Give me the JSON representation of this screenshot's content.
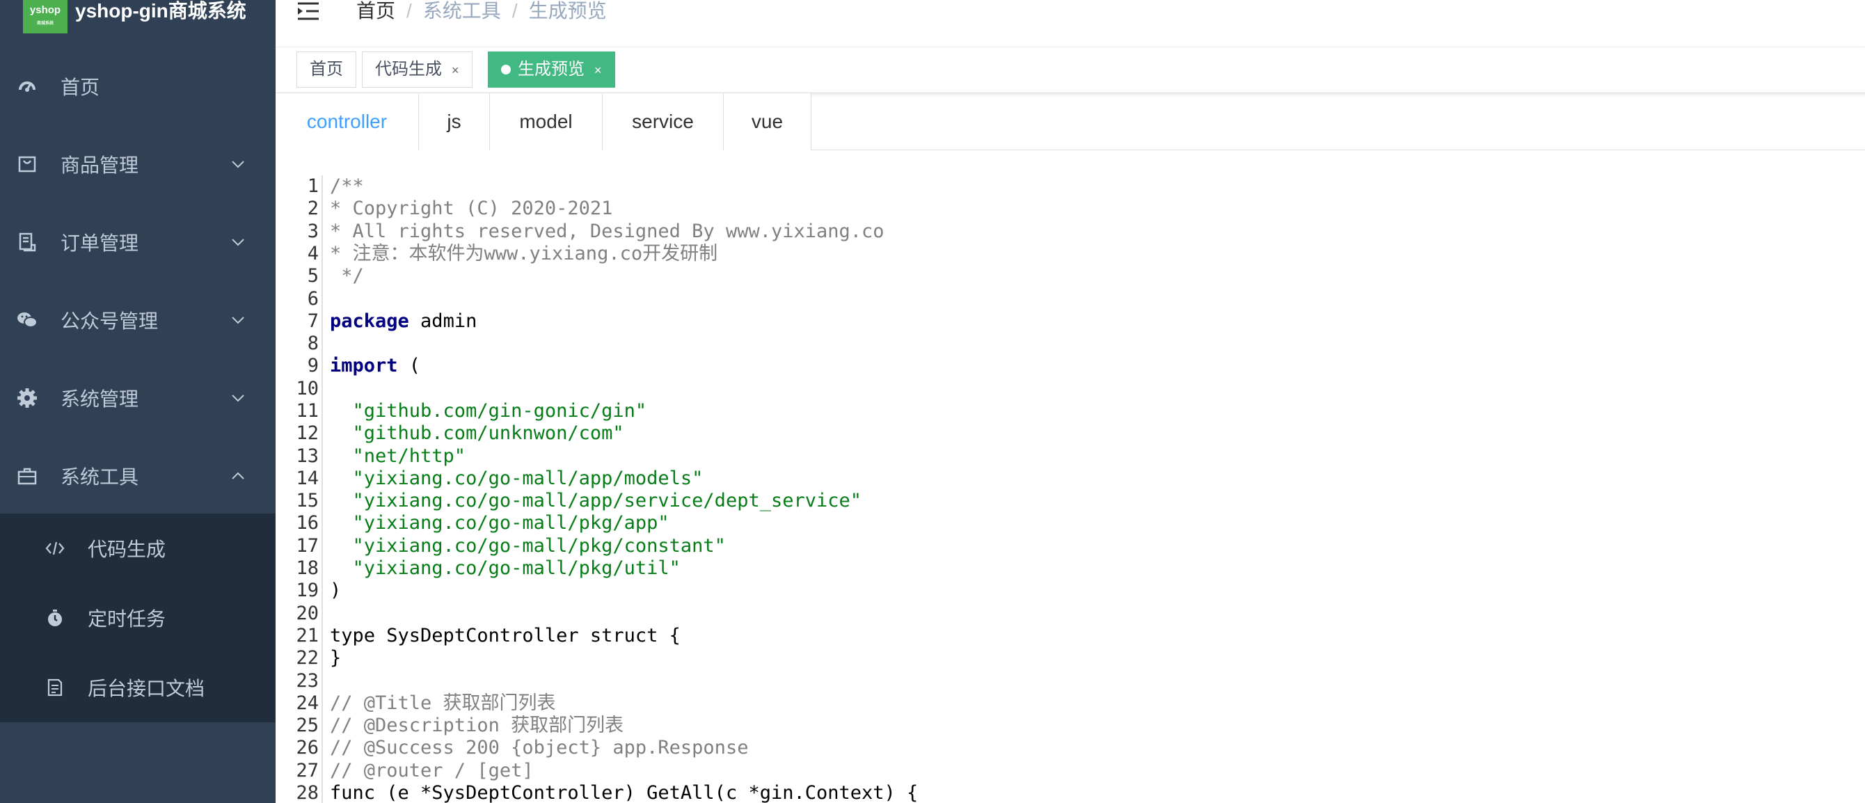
{
  "app": {
    "logo_text": "yshop",
    "logo_subtext": "商城系统",
    "title": "yshop-gin商城系统"
  },
  "sidebar": {
    "items": [
      {
        "label": "首页",
        "icon": "dashboard-icon"
      },
      {
        "label": "商品管理",
        "icon": "shopping-bag-icon"
      },
      {
        "label": "订单管理",
        "icon": "order-icon"
      },
      {
        "label": "公众号管理",
        "icon": "wechat-icon"
      },
      {
        "label": "系统管理",
        "icon": "gear-icon"
      },
      {
        "label": "系统工具",
        "icon": "toolbox-icon"
      }
    ],
    "submenu": [
      {
        "label": "代码生成",
        "icon": "code-icon"
      },
      {
        "label": "定时任务",
        "icon": "timer-icon"
      },
      {
        "label": "后台接口文档",
        "icon": "doc-icon"
      }
    ]
  },
  "breadcrumb": {
    "home": "首页",
    "separator": "/",
    "level1": "系统工具",
    "level2": "生成预览"
  },
  "tags": [
    {
      "label": "首页",
      "closable": false,
      "active": false
    },
    {
      "label": "代码生成",
      "closable": true,
      "active": false
    },
    {
      "label": "生成预览",
      "closable": true,
      "active": true
    }
  ],
  "tag_close_glyph": "×",
  "tabs": [
    {
      "label": "controller",
      "active": true
    },
    {
      "label": "js",
      "active": false
    },
    {
      "label": "model",
      "active": false
    },
    {
      "label": "service",
      "active": false
    },
    {
      "label": "vue",
      "active": false
    }
  ],
  "code": [
    {
      "n": "1",
      "t": "/**",
      "s": "cm"
    },
    {
      "n": "2",
      "t": "* Copyright (C) 2020-2021",
      "s": "cm"
    },
    {
      "n": "3",
      "t": "* All rights reserved, Designed By www.yixiang.co",
      "s": "cm"
    },
    {
      "n": "4",
      "t": "* 注意：本软件为www.yixiang.co开发研制",
      "s": "cm"
    },
    {
      "n": "5",
      "t": " */",
      "s": "cm"
    },
    {
      "n": "6",
      "t": "",
      "s": "pl"
    },
    {
      "n": "7",
      "kw": "package",
      "t": " admin",
      "s": "pl"
    },
    {
      "n": "8",
      "t": "",
      "s": "pl"
    },
    {
      "n": "9",
      "kw": "import",
      "t": " (",
      "s": "pl"
    },
    {
      "n": "10",
      "t": "",
      "s": "pl"
    },
    {
      "n": "11",
      "t": "  \"github.com/gin-gonic/gin\"",
      "s": "str"
    },
    {
      "n": "12",
      "t": "  \"github.com/unknwon/com\"",
      "s": "str"
    },
    {
      "n": "13",
      "t": "  \"net/http\"",
      "s": "str"
    },
    {
      "n": "14",
      "t": "  \"yixiang.co/go-mall/app/models\"",
      "s": "str"
    },
    {
      "n": "15",
      "t": "  \"yixiang.co/go-mall/app/service/dept_service\"",
      "s": "str"
    },
    {
      "n": "16",
      "t": "  \"yixiang.co/go-mall/pkg/app\"",
      "s": "str"
    },
    {
      "n": "17",
      "t": "  \"yixiang.co/go-mall/pkg/constant\"",
      "s": "str"
    },
    {
      "n": "18",
      "t": "  \"yixiang.co/go-mall/pkg/util\"",
      "s": "str"
    },
    {
      "n": "19",
      "t": ")",
      "s": "pl"
    },
    {
      "n": "20",
      "t": "",
      "s": "pl"
    },
    {
      "n": "21",
      "t": "type SysDeptController struct {",
      "s": "pl"
    },
    {
      "n": "22",
      "t": "}",
      "s": "pl"
    },
    {
      "n": "23",
      "t": "",
      "s": "pl"
    },
    {
      "n": "24",
      "t": "// @Title 获取部门列表",
      "s": "cm"
    },
    {
      "n": "25",
      "t": "// @Description 获取部门列表",
      "s": "cm"
    },
    {
      "n": "26",
      "t": "// @Success 200 {object} app.Response",
      "s": "cm"
    },
    {
      "n": "27",
      "t": "// @router / [get]",
      "s": "cm"
    },
    {
      "n": "28",
      "t": "func (e *SysDeptController) GetAll(c *gin.Context) {",
      "s": "pl"
    }
  ],
  "colors": {
    "sidebar_bg": "#304156",
    "submenu_bg": "#1f2d3d",
    "active_tag": "#42b983",
    "active_tab": "#409eff",
    "keyword": "#000080",
    "string": "#067d17",
    "comment": "#808080"
  }
}
